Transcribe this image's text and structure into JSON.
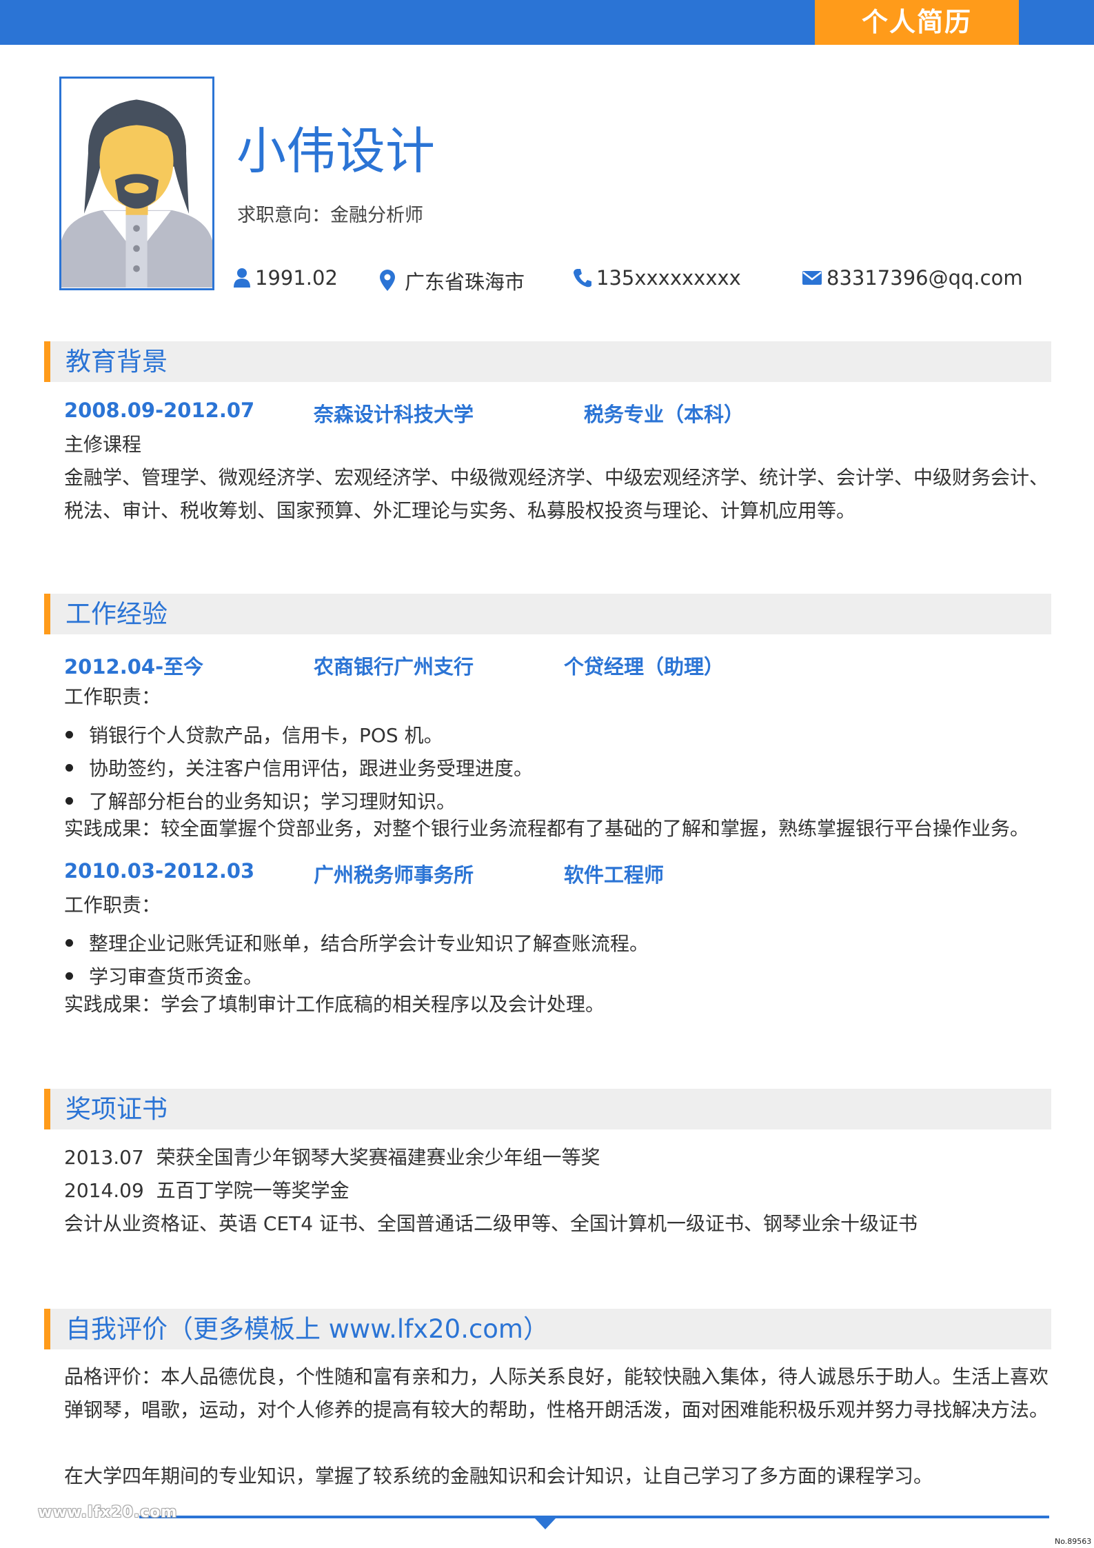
{
  "header": {
    "tag": "个人简历"
  },
  "profile": {
    "name": "小伟设计",
    "intent": "求职意向：金融分析师",
    "birth": "1991.02",
    "city": "广东省珠海市",
    "phone": "135xxxxxxxxx",
    "email": "83317396@qq.com"
  },
  "education": {
    "title": "教育背景",
    "period": "2008.09-2012.07",
    "school": "奈森设计科技大学",
    "major": "税务专业（本科）",
    "courses_label": "主修课程",
    "courses": "金融学、管理学、微观经济学、宏观经济学、中级微观经济学、中级宏观经济学、统计学、会计学、中级财务会计、税法、审计、税收筹划、国家预算、外汇理论与实务、私募股权投资与理论、计算机应用等。"
  },
  "work": {
    "title": "工作经验",
    "jobs": [
      {
        "period": "2012.04-至今",
        "company": "农商银行广州支行",
        "position": "个贷经理（助理）",
        "duty_label": "工作职责：",
        "duties": [
          "销银行个人贷款产品，信用卡，POS 机。",
          "协助签约，关注客户信用评估，跟进业务受理进度。",
          "了解部分柜台的业务知识；学习理财知识。"
        ],
        "result": "实践成果：较全面掌握个贷部业务，对整个银行业务流程都有了基础的了解和掌握，熟练掌握银行平台操作业务。"
      },
      {
        "period": "2010.03-2012.03",
        "company": "广州税务师事务所",
        "position": "软件工程师",
        "duty_label": "工作职责：",
        "duties": [
          "整理企业记账凭证和账单，结合所学会计专业知识了解查账流程。",
          "学习审查货币资金。"
        ],
        "result": "实践成果：学会了填制审计工作底稿的相关程序以及会计处理。"
      }
    ]
  },
  "awards": {
    "title": "奖项证书",
    "items": [
      "2013.07  荣获全国青少年钢琴大奖赛福建赛业余少年组一等奖",
      "2014.09  五百丁学院一等奖学金",
      "会计从业资格证、英语 CET4 证书、全国普通话二级甲等、全国计算机一级证书、钢琴业余十级证书"
    ]
  },
  "self": {
    "title": "自我评价（更多模板上 www.lfx20.com）",
    "para1": "品格评价：本人品德优良，个性随和富有亲和力，人际关系良好，能较快融入集体，待人诚恳乐于助人。生活上喜欢弹钢琴，唱歌，运动，对个人修养的提高有较大的帮助，性格开朗活泼，面对困难能积极乐观并努力寻找解决方法。",
    "para2": "在大学四年期间的专业知识，掌握了较系统的金融知识和会计知识，让自己学习了多方面的课程学习。"
  },
  "footer": {
    "watermark": "www.lfx20.com",
    "doc_no": "No.89563"
  },
  "colors": {
    "primary": "#2b74d5",
    "accent": "#ff9b1a",
    "section_bg": "#eeeeee"
  },
  "icons": {
    "birth": "user-icon",
    "city": "location-pin-icon",
    "phone": "phone-icon",
    "email": "mail-icon"
  }
}
